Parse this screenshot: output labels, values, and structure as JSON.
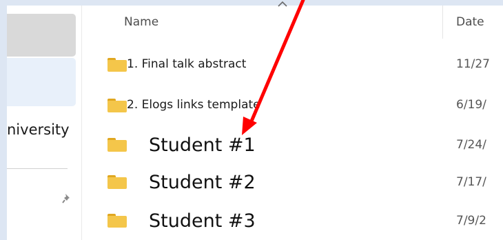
{
  "nav": {
    "label": "niversity"
  },
  "columns": {
    "name": "Name",
    "date": "Date"
  },
  "files": [
    {
      "name": "1. Final talk abstract",
      "date": "11/27"
    },
    {
      "name": "2. Elogs links template",
      "date": "6/19/"
    },
    {
      "name": "Student #1",
      "date": "7/24/"
    },
    {
      "name": "Student #2",
      "date": "7/17/"
    },
    {
      "name": "Student #3",
      "date": "7/9/2"
    }
  ],
  "colors": {
    "arrow": "#ff0000",
    "folder": "#f4c64a",
    "nav_selected": "#e8f0fa"
  },
  "icons": [
    "folder-icon",
    "pin-icon",
    "sort-caret-icon",
    "annotation-arrow"
  ]
}
